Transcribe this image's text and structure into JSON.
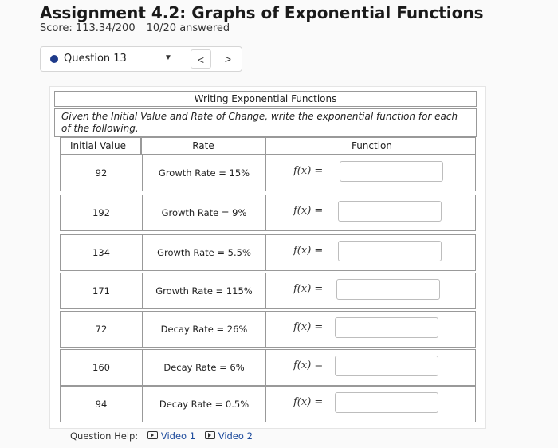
{
  "header": {
    "title": "Assignment 4.2: Graphs of Exponential Functions",
    "score": "Score: 113.34/200",
    "answered": "10/20 answered"
  },
  "question_selector": {
    "label": "Question 13",
    "caret_icon": "caret-down-icon",
    "prev": "<",
    "next": ">"
  },
  "problem": {
    "heading": "Writing Exponential Functions",
    "instructions": "Given the Initial Value and Rate of Change, write the exponential function for each of the following.",
    "columns": [
      "Initial Value",
      "Rate",
      "Function"
    ],
    "rows": [
      {
        "initial": "92",
        "rate": "Growth Rate = 15%",
        "fx": "f(x) =",
        "answer": ""
      },
      {
        "initial": "192",
        "rate": "Growth Rate = 9%",
        "fx": "f(x) =",
        "answer": ""
      },
      {
        "initial": "134",
        "rate": "Growth Rate = 5.5%",
        "fx": "f(x) =",
        "answer": ""
      },
      {
        "initial": "171",
        "rate": "Growth Rate = 115%",
        "fx": "f(x) =",
        "answer": ""
      },
      {
        "initial": "72",
        "rate": "Decay Rate = 26%",
        "fx": "f(x) =",
        "answer": ""
      },
      {
        "initial": "160",
        "rate": "Decay Rate = 6%",
        "fx": "f(x) =",
        "answer": ""
      },
      {
        "initial": "94",
        "rate": "Decay Rate = 0.5%",
        "fx": "f(x) =",
        "answer": ""
      }
    ]
  },
  "help": {
    "label": "Question Help:",
    "video1": "Video 1",
    "video2": "Video 2"
  }
}
